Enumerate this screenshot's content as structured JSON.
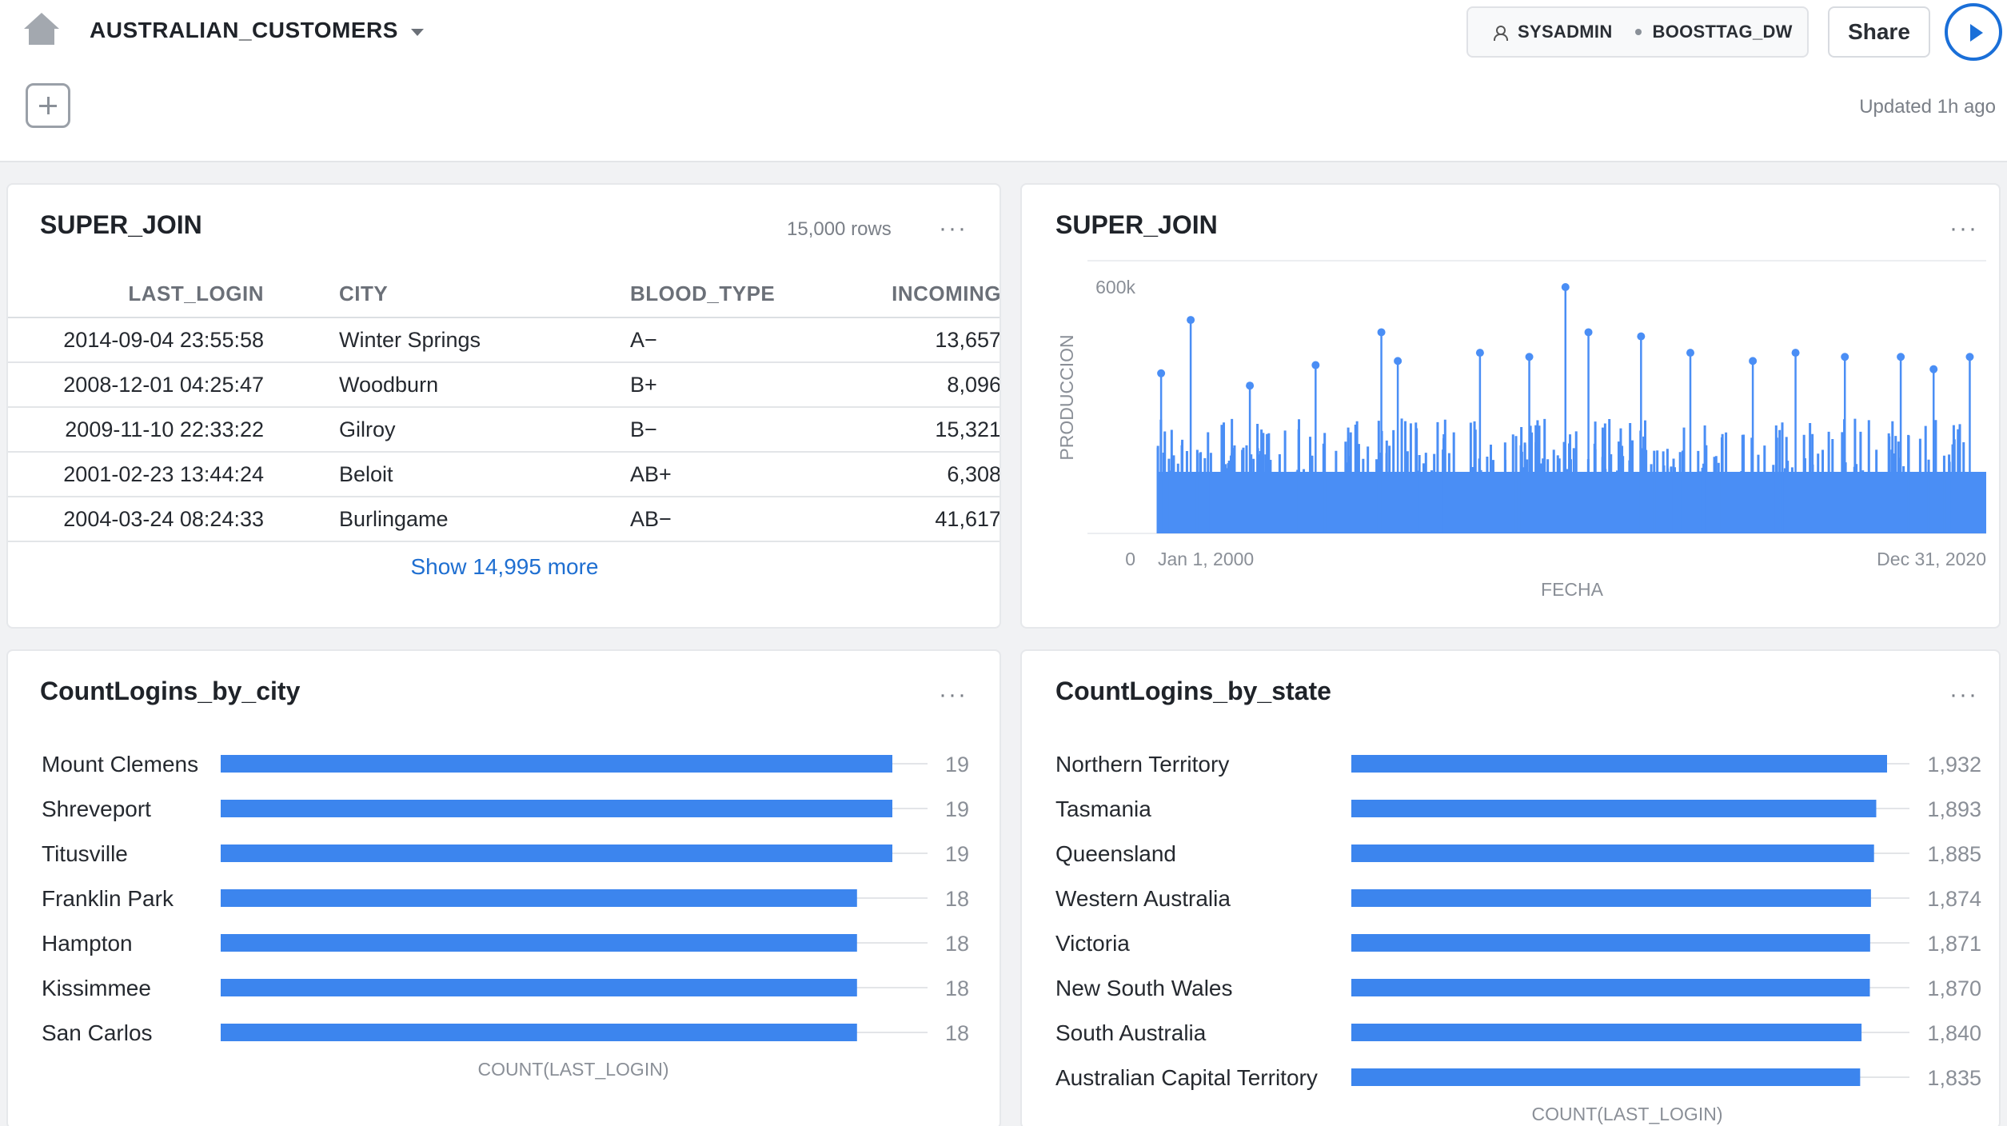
{
  "header": {
    "title": "AUSTRALIAN_CUSTOMERS",
    "role": "SYSADMIN",
    "warehouse": "BOOSTTAG_DW",
    "share_label": "Share",
    "updated": "Updated 1h ago"
  },
  "table_card": {
    "title": "SUPER_JOIN",
    "row_count": "15,000 rows",
    "menu": "···",
    "columns": [
      "LAST_LOGIN",
      "CITY",
      "BLOOD_TYPE",
      "INCOMING"
    ],
    "rows": [
      [
        "2014-09-04 23:55:58",
        "Winter Springs",
        "A−",
        "13,657"
      ],
      [
        "2008-12-01 04:25:47",
        "Woodburn",
        "B+",
        "8,096"
      ],
      [
        "2009-11-10 22:33:22",
        "Gilroy",
        "B−",
        "15,321"
      ],
      [
        "2001-02-23 13:44:24",
        "Beloit",
        "AB+",
        "6,308"
      ],
      [
        "2004-03-24 08:24:33",
        "Burlingame",
        "AB−",
        "41,617"
      ]
    ],
    "show_more": "Show 14,995 more"
  },
  "chart_cards": {
    "super_join": {
      "title": "SUPER_JOIN",
      "menu": "···"
    },
    "by_city": {
      "title": "CountLogins_by_city",
      "menu": "···"
    },
    "by_state": {
      "title": "CountLogins_by_state",
      "menu": "···"
    }
  },
  "chart_data": [
    {
      "type": "line",
      "title": "SUPER_JOIN",
      "xlabel": "FECHA",
      "ylabel": "PRODUCCION",
      "x_ticks": [
        "Jan 1, 2000",
        "Dec 31, 2020"
      ],
      "y_ticks": [
        "0",
        "600k"
      ],
      "ylim": [
        0,
        600000
      ],
      "color": "#4a8ef5",
      "series": [
        {
          "x": [
            "2000-02",
            "2000-11",
            "2002-05",
            "2004-01",
            "2005-09",
            "2006-02",
            "2008-03",
            "2009-06",
            "2010-05",
            "2010-12",
            "2012-04",
            "2013-07",
            "2015-02",
            "2016-03",
            "2017-06",
            "2018-11",
            "2019-09",
            "2020-08"
          ],
          "y": [
            390000,
            520000,
            360000,
            410000,
            490000,
            420000,
            440000,
            430000,
            600000,
            490000,
            480000,
            440000,
            420000,
            440000,
            430000,
            430000,
            400000,
            430000
          ]
        }
      ],
      "baseline_band": [
        150000,
        280000
      ]
    },
    {
      "type": "bar",
      "orientation": "horizontal",
      "title": "CountLogins_by_city",
      "xlabel": "COUNT(LAST_LOGIN)",
      "color": "#3c85ee",
      "categories": [
        "Mount Clemens",
        "Shreveport",
        "Titusville",
        "Franklin Park",
        "Hampton",
        "Kissimmee",
        "San Carlos"
      ],
      "values": [
        19,
        19,
        19,
        18,
        18,
        18,
        18
      ]
    },
    {
      "type": "bar",
      "orientation": "horizontal",
      "title": "CountLogins_by_state",
      "xlabel": "COUNT(LAST_LOGIN)",
      "color": "#3c85ee",
      "categories": [
        "Northern Territory",
        "Tasmania",
        "Queensland",
        "Western Australia",
        "Victoria",
        "New South Wales",
        "South Australia",
        "Australian Capital Territory"
      ],
      "values": [
        1932,
        1893,
        1885,
        1874,
        1871,
        1870,
        1840,
        1835
      ],
      "value_labels": [
        "1,932",
        "1,893",
        "1,885",
        "1,874",
        "1,871",
        "1,870",
        "1,840",
        "1,835"
      ]
    }
  ]
}
